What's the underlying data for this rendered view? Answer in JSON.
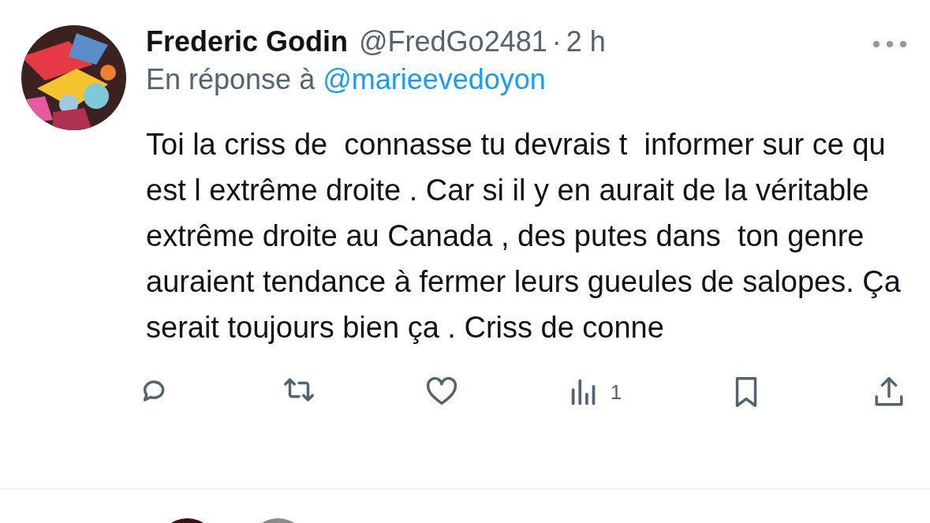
{
  "tweet": {
    "author": {
      "name": "Frederic Godin",
      "handle": "@FredGo2481",
      "separator": "·",
      "time": "2 h"
    },
    "reply_to": {
      "label": "En réponse à",
      "handle": "@marieevedoyon"
    },
    "text": "Toi la criss de  connasse tu devrais t  informer sur ce qu est l extrême droite . Car si il y en aurait de la véritable extrême droite au Canada , des putes dans  ton genre auraient tendance à fermer leurs gueules de salopes. Ça serait toujours bien ça . Criss de conne",
    "actions": [
      {
        "kind": "reply"
      },
      {
        "kind": "retweet"
      },
      {
        "kind": "like"
      },
      {
        "kind": "views",
        "count": "1"
      },
      {
        "kind": "bookmark"
      },
      {
        "kind": "share"
      }
    ]
  },
  "next_avatars": [
    {
      "kind": "avatar",
      "color": "#3a1414"
    },
    {
      "kind": "avatar",
      "color": "#8a8a8a"
    }
  ]
}
